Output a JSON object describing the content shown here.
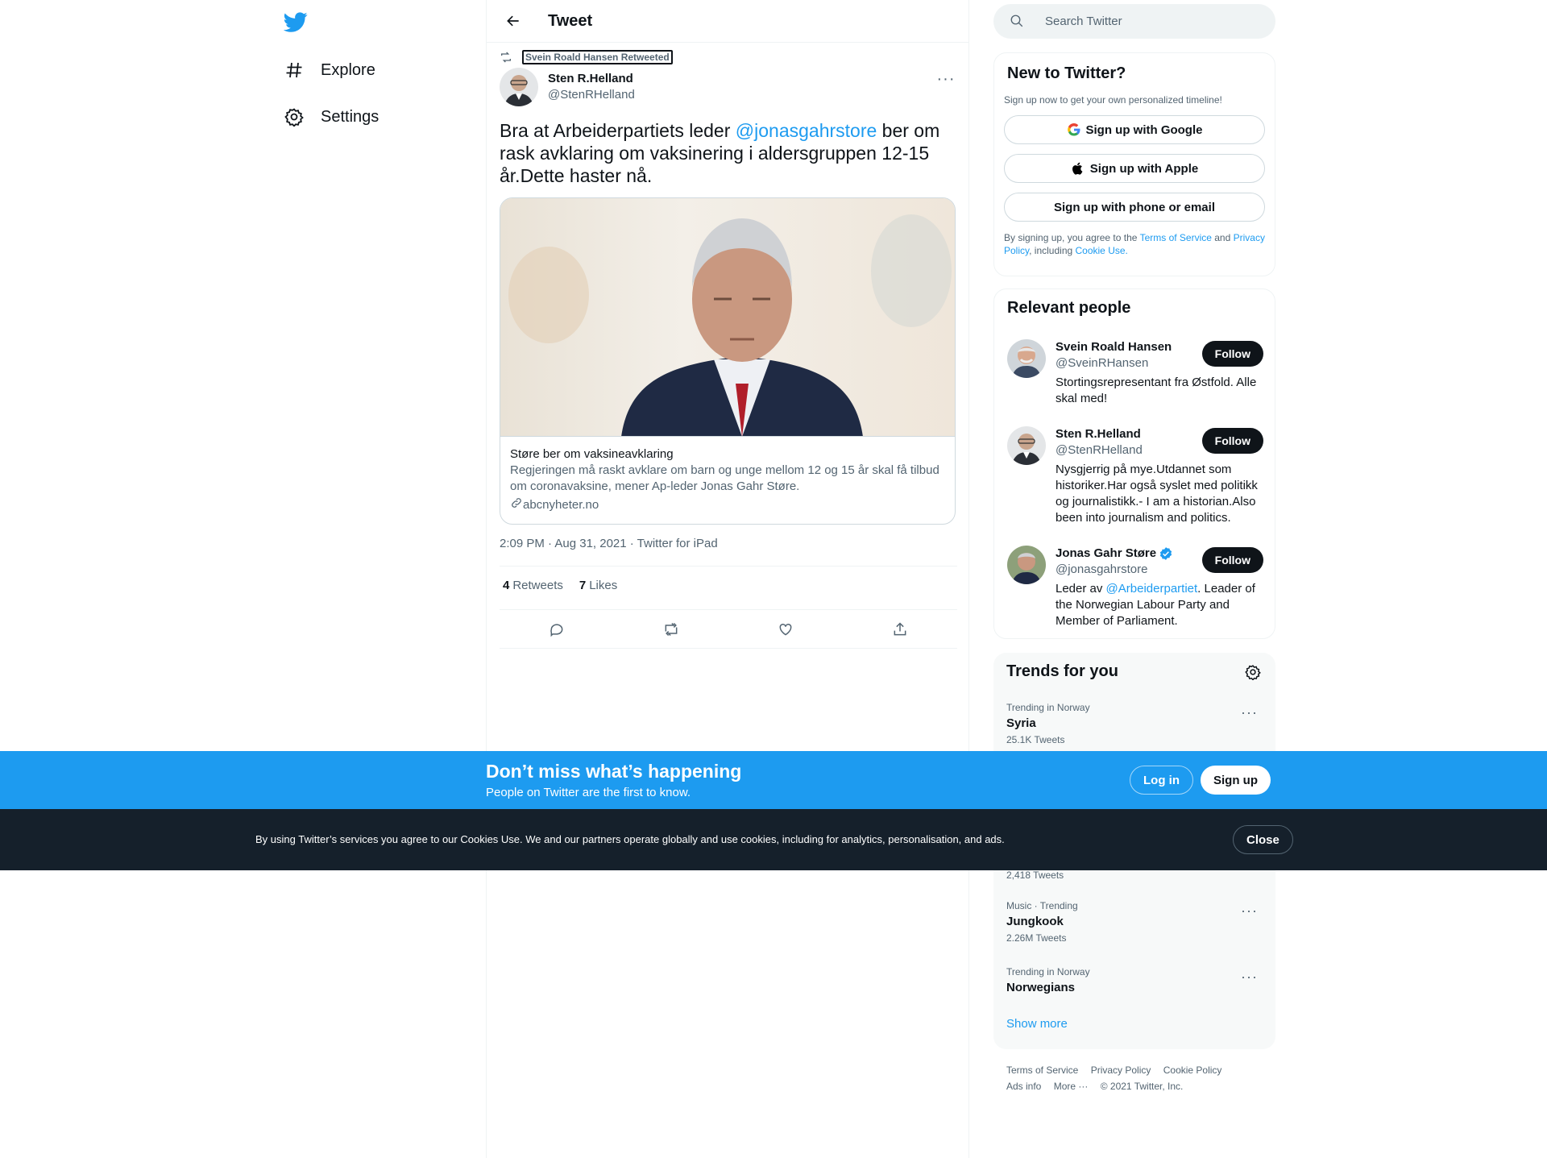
{
  "colors": {
    "accent": "#1d9bf0",
    "text": "#0f1419",
    "muted": "#536471",
    "dark_bar": "#15202b"
  },
  "nav": {
    "logo_icon": "twitter-bird-icon",
    "items": [
      {
        "label": "Explore",
        "icon": "hashtag-icon"
      },
      {
        "label": "Settings",
        "icon": "gear-icon"
      }
    ]
  },
  "header": {
    "title": "Tweet",
    "back_icon": "arrow-left-icon"
  },
  "tweet": {
    "retweeted_by": "Svein Roald Hansen Retweeted",
    "author_name": "Sten R.Helland",
    "author_handle": "@StenRHelland",
    "text_before": "Bra at Arbeiderpartiets leder ",
    "mention": "@jonasgahrstore",
    "text_after": " ber om rask avklaring om vaksinering i aldersgruppen 12-15 år.Dette haster nå.",
    "card": {
      "title": "Støre ber om vaksineavklaring",
      "description": "Regjeringen må raskt avklare om barn og unge mellom 12 og 15 år skal få tilbud om coronavaksine, mener Ap-leder Jonas Gahr Støre.",
      "domain": "abcnyheter.no"
    },
    "meta": "2:09 PM · Aug 31, 2021 · Twitter for iPad",
    "retweets_count": "4",
    "retweets_label": "Retweets",
    "likes_count": "7",
    "likes_label": "Likes"
  },
  "search": {
    "placeholder": "Search Twitter"
  },
  "new_to_twitter": {
    "title": "New to Twitter?",
    "subtitle": "Sign up now to get your own personalized timeline!",
    "google_label": "Sign up with Google",
    "apple_label": "Sign up with Apple",
    "email_label": "Sign up with phone or email",
    "legal_1": "By signing up, you agree to the ",
    "terms": "Terms of Service",
    "legal_2": " and ",
    "privacy": "Privacy Policy",
    "legal_3": ", including ",
    "cookie": "Cookie Use",
    "legal_4": "."
  },
  "relevant_people": {
    "title": "Relevant people",
    "follow_label": "Follow",
    "people": [
      {
        "name": "Svein Roald Hansen",
        "handle": "@SveinRHansen",
        "bio": "Stortingsrepresentant fra Østfold. Alle skal med!"
      },
      {
        "name": "Sten R.Helland",
        "handle": "@StenRHelland",
        "bio": "Nysgjerrig på mye.Utdannet som historiker.Har også syslet med politikk og journalistikk.- I am a historian.Also been into journalism and politics."
      },
      {
        "name": "Jonas Gahr Støre",
        "handle": "@jonasgahrstore",
        "bio_before": "Leder av ",
        "bio_mention": "@Arbeiderpartiet",
        "bio_after": ". Leader of the Norwegian Labour Party and Member of Parliament."
      }
    ]
  },
  "trends": {
    "title": "Trends for you",
    "items": [
      {
        "context": "Trending in Norway",
        "name": "Syria",
        "count": "25.1K Tweets"
      },
      {
        "count": "2,418 Tweets"
      },
      {
        "context": "Music · Trending",
        "name": "Jungkook",
        "count": "2.26M Tweets"
      },
      {
        "context": "Trending in Norway",
        "name": "Norwegians"
      }
    ],
    "show_more": "Show more"
  },
  "footer": {
    "links": [
      "Terms of Service",
      "Privacy Policy",
      "Cookie Policy",
      "Ads info",
      "More ···",
      "© 2021 Twitter, Inc."
    ]
  },
  "promo": {
    "title": "Don’t miss what’s happening",
    "subtitle": "People on Twitter are the first to know.",
    "login": "Log in",
    "signup": "Sign up"
  },
  "cookie_bar": {
    "text": "By using Twitter’s services you agree to our Cookies Use. We and our partners operate globally and use cookies, including for analytics, personalisation, and ads.",
    "close": "Close"
  }
}
